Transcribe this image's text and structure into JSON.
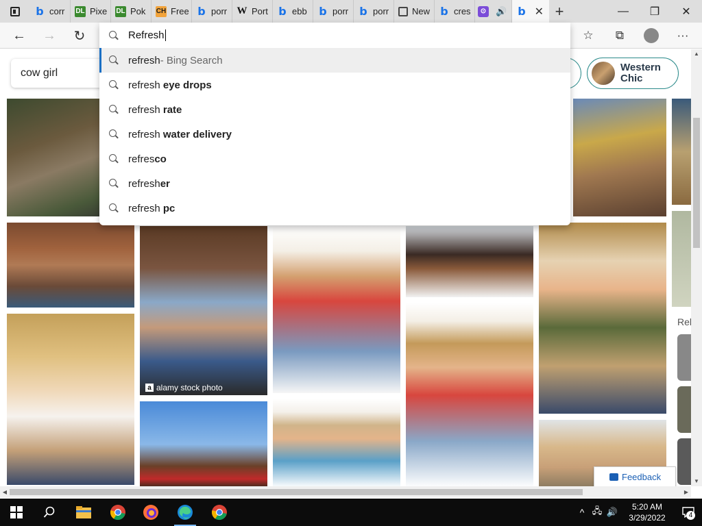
{
  "tabs": [
    {
      "label": "corr",
      "icon": "bing-icon"
    },
    {
      "label": "Pixe",
      "icon": "dl-icon"
    },
    {
      "label": "Pok",
      "icon": "dl-icon"
    },
    {
      "label": "Free",
      "icon": "ch-icon"
    },
    {
      "label": "porr",
      "icon": "bing-icon"
    },
    {
      "label": "Port",
      "icon": "wikipedia-icon"
    },
    {
      "label": "ebb",
      "icon": "bing-icon"
    },
    {
      "label": "porr",
      "icon": "bing-icon"
    },
    {
      "label": "porr",
      "icon": "bing-icon"
    },
    {
      "label": "New",
      "icon": "newtab-icon"
    },
    {
      "label": "cres",
      "icon": "bing-icon"
    }
  ],
  "glyphs": {
    "bing": "b",
    "dl": "DL",
    "ch": "CH",
    "w": "W",
    "tw": "⊙"
  },
  "controls": {
    "close": "✕",
    "new_tab": "+",
    "minimize": "—",
    "restore": "❐",
    "win_close": "✕",
    "back": "←",
    "forward": "→",
    "refresh": "↻",
    "favorites": "☆",
    "collections": "⧉",
    "menu": "···",
    "speaker": "🔊"
  },
  "omnibox": {
    "typed": "Refresh",
    "suggestions": [
      {
        "prefix": "refresh",
        "bold": "",
        "muted": " - Bing Search",
        "selected": true
      },
      {
        "prefix": "refresh ",
        "bold": "eye drops",
        "muted": ""
      },
      {
        "prefix": "refresh ",
        "bold": "rate",
        "muted": ""
      },
      {
        "prefix": "refresh ",
        "bold": "water delivery",
        "muted": ""
      },
      {
        "prefix": "refres",
        "bold": "co",
        "muted": ""
      },
      {
        "prefix": "refresh",
        "bold": "er",
        "muted": ""
      },
      {
        "prefix": "refresh ",
        "bold": "pc",
        "muted": ""
      }
    ]
  },
  "page": {
    "search_query": "cow girl",
    "chip_label": "Western Chic",
    "watermark": "alamy stock photo",
    "watermark_logo": "a",
    "related_label": "Rel",
    "feedback_label": "Feedback"
  },
  "scroll": {
    "up": "▲",
    "down": "▼",
    "left": "◀",
    "right": "▶"
  },
  "taskbar": {
    "time": "5:20 AM",
    "date": "3/29/2022",
    "notification_count": "4",
    "tray_up": "^",
    "tray_network": "🖧",
    "tray_volume": "🔊"
  }
}
